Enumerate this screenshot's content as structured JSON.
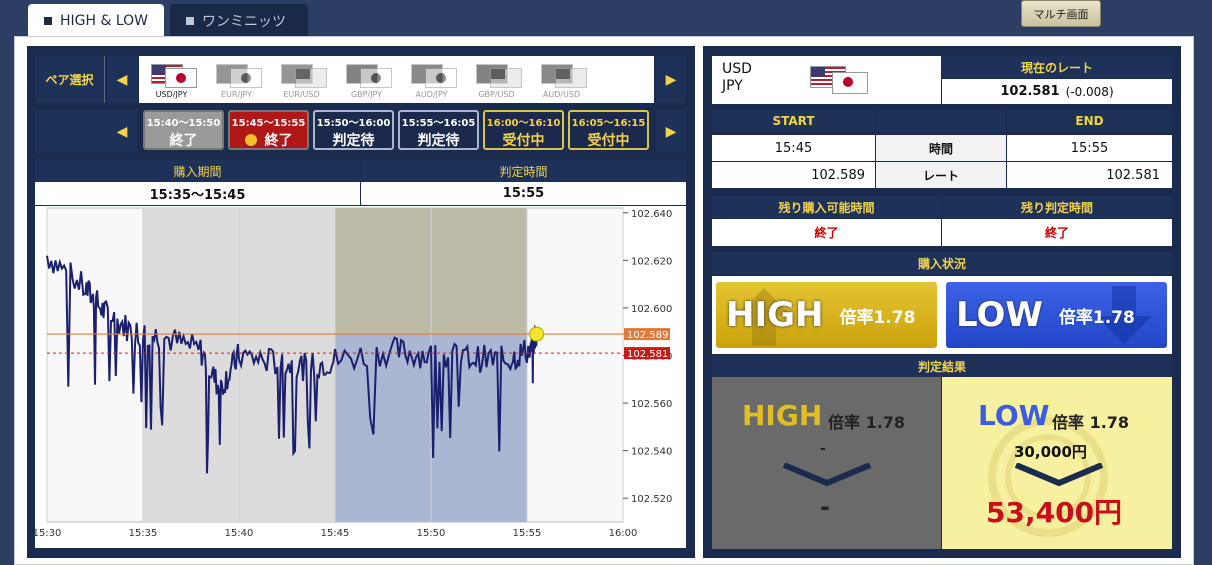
{
  "tabs": {
    "active": "HIGH & LOW",
    "other": "ワンミニッツ"
  },
  "multi_button": "マルチ画面",
  "pair_select_label": "ペア選択",
  "pairs": [
    {
      "label": "USD/JPY",
      "flags": [
        "us",
        "jp"
      ]
    },
    {
      "label": "EUR/JPY",
      "flags": [
        "eu",
        "jp"
      ]
    },
    {
      "label": "EUR/USD",
      "flags": [
        "eu",
        "us"
      ]
    },
    {
      "label": "GBP/JPY",
      "flags": [
        "uk",
        "jp"
      ]
    },
    {
      "label": "AUD/JPY",
      "flags": [
        "au",
        "jp"
      ]
    },
    {
      "label": "GBP/USD",
      "flags": [
        "uk",
        "us"
      ]
    },
    {
      "label": "AUD/USD",
      "flags": [
        "au",
        "us"
      ]
    }
  ],
  "slots": [
    {
      "time": "15:40〜15:50",
      "status": "終了",
      "kind": "end"
    },
    {
      "time": "15:45〜15:55",
      "status": "終了",
      "kind": "endred"
    },
    {
      "time": "15:50〜16:00",
      "status": "判定待",
      "kind": "judge"
    },
    {
      "time": "15:55〜16:05",
      "status": "判定待",
      "kind": "judge"
    },
    {
      "time": "16:00〜16:10",
      "status": "受付中",
      "kind": "open"
    },
    {
      "time": "16:05〜16:15",
      "status": "受付中",
      "kind": "open"
    }
  ],
  "period": {
    "buy_label": "購入期間",
    "buy_value": "15:35〜15:45",
    "judge_label": "判定時間",
    "judge_value": "15:55"
  },
  "chart_data": {
    "type": "line",
    "x_ticks": [
      "15:30",
      "15:35",
      "15:40",
      "15:45",
      "15:50",
      "15:55",
      "16:00"
    ],
    "y_ticks": [
      102.64,
      102.62,
      102.6,
      102.58,
      102.56,
      102.54,
      102.52
    ],
    "y_tick_labels": [
      "102.640",
      "102.620",
      "102.600",
      "102.580",
      "102.560",
      "102.540",
      "102.520"
    ],
    "ylim": [
      102.51,
      102.642
    ],
    "xlim_minutes": [
      0,
      30
    ],
    "start_rate_label": "102.589",
    "current_rate_label": "102.581",
    "start_rate": 102.589,
    "current_rate": 102.581,
    "shaded_buy_period": [
      5,
      15
    ],
    "shaded_judge_period": [
      15,
      25
    ],
    "colors": {
      "line": "#1a1f6e",
      "start_line": "#e07a3a",
      "current_line": "#d02020"
    }
  },
  "rate_panel": {
    "pair_top": "USD",
    "pair_bottom": "JPY",
    "current_rate_label": "現在のレート",
    "current_rate": "102.581",
    "change": "(-0.008)"
  },
  "start_end": {
    "start_label": "START",
    "end_label": "END",
    "time_label": "時間",
    "rate_label": "レート",
    "start_time": "15:45",
    "end_time": "15:55",
    "start_rate": "102.589",
    "end_rate": "102.581"
  },
  "remaining": {
    "buy_label": "残り購入可能時間",
    "buy_value": "終了",
    "judge_label": "残り判定時間",
    "judge_value": "終了"
  },
  "purchase_status": "購入状況",
  "buttons": {
    "high": "HIGH",
    "high_rate": "倍率1.78",
    "low": "LOW",
    "low_rate": "倍率1.78"
  },
  "result": {
    "title": "判定結果",
    "high": "HIGH",
    "high_rate": "倍率 1.78",
    "high_amount": "-",
    "high_payout": "-",
    "low": "LOW",
    "low_rate": "倍率 1.78",
    "low_amount": "30,000円",
    "low_payout": "53,400円"
  }
}
